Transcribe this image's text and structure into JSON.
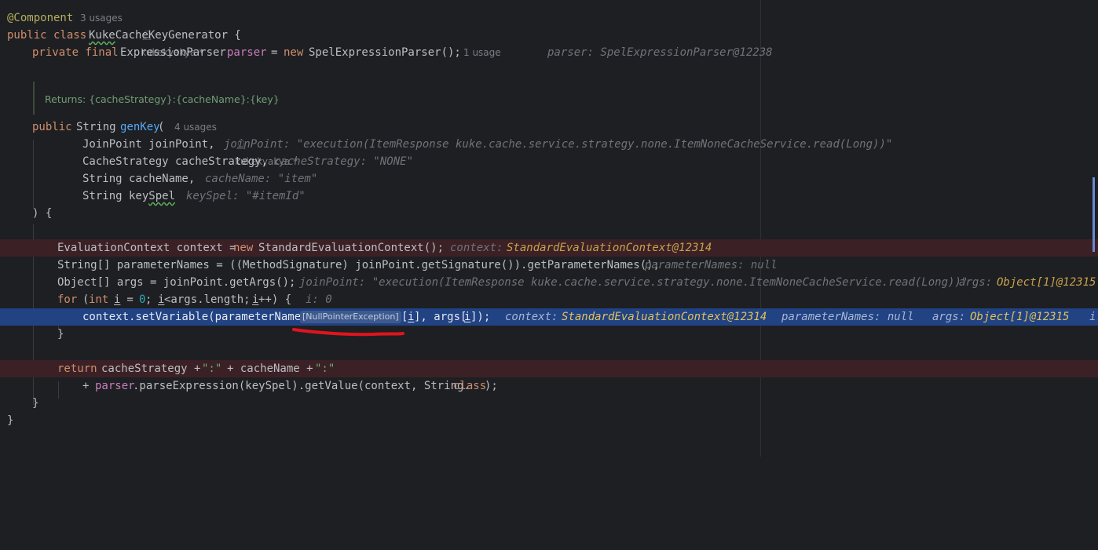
{
  "class_header": {
    "annotation": "@Component",
    "usages": "3 usages",
    "author": "kukekyakya *",
    "decl_kw": "public class",
    "class_prefix": "Kuke",
    "class_suffix": "CacheKeyGenerator {"
  },
  "field": {
    "modifiers": "private final",
    "type": "ExpressionParser",
    "name": "parser",
    "assign": "=",
    "new_kw": "new",
    "init": "SpelExpressionParser();",
    "usages": "1 usage",
    "hint": "parser: SpelExpressionParser@12238"
  },
  "doc": {
    "text": "Returns: {cacheStrategy}:{cacheName}:{key}"
  },
  "method": {
    "modifiers": "public",
    "return_type": "String",
    "name": "genKey",
    "paren": "(",
    "usages": "4 usages",
    "author": "kukekyakya *",
    "params": [
      {
        "code": "JoinPoint joinPoint,",
        "hint": "joinPoint: \"execution(ItemResponse kuke.cache.service.strategy.none.ItemNoneCacheService.read(Long))\""
      },
      {
        "code": "CacheStrategy cacheStrategy,",
        "hint": "cacheStrategy: \"NONE\""
      },
      {
        "code": "String cacheName,",
        "hint": "cacheName: \"item\""
      },
      {
        "code_prefix": "String key",
        "code_squig": "Spel",
        "hint": "keySpel: \"#itemId\""
      }
    ],
    "close": ") {"
  },
  "body": {
    "l1_code": "EvaluationContext context =",
    "l1_new": "new",
    "l1_rest": "StandardEvaluationContext();",
    "l1_hint_label": "context:",
    "l1_hint_val": "StandardEvaluationContext@12314",
    "l2_code": "String[] parameterNames = ((MethodSignature) joinPoint.getSignature()).getParameterNames();",
    "l2_hint": "parameterNames: null",
    "l3_code": "Object[] args = joinPoint.getArgs();",
    "l3_hint": "joinPoint: \"execution(ItemResponse kuke.cache.service.strategy.none.ItemNoneCacheService.read(Long))\"",
    "l3_hint2_label": "args:",
    "l3_hint2_val": "Object[1]@12315",
    "l4_for": "for",
    "l4_open": "(",
    "l4_int": "int",
    "l4_i": "i",
    "l4_eq": " =",
    "l4_zero": "0",
    "l4_semi": ";",
    "l4_cond": "<args.length; ",
    "l4_inc": "++) {",
    "l4_hint": "i: 0",
    "l5_code": "context.setVariable(parameterNames",
    "l5_badge": "[NullPointerException]",
    "l5_idx_open": "[",
    "l5_idx_close": "], args[",
    "l5_end": "]);",
    "l5_hint1_label": "context:",
    "l5_hint1_val": "StandardEvaluationContext@12314",
    "l5_hint2": "parameterNames: null",
    "l5_hint3_label": "args:",
    "l5_hint3_val": "Object[1]@12315",
    "l5_hint4": "i:",
    "close_brace": "}",
    "ret_kw": "return",
    "ret_code": "cacheStrategy +",
    "ret_str1": "\":\"",
    "ret_mid": "+ cacheName +",
    "ret_str2": "\":\"",
    "cont_plus": "+",
    "cont_field": "parser",
    "cont_rest": ".parseExpression(keySpel).getValue(context, String.",
    "cont_class": "class",
    "cont_end": ");",
    "method_close": "}",
    "class_close": "}"
  },
  "colors": {
    "background": "#1e1f22",
    "breakpoint_line": "#3b2126",
    "execution_line": "#214283",
    "annotation": "#b3ae60",
    "keyword": "#cf8e6d",
    "method": "#56a8f5",
    "field": "#c77dbb",
    "string": "#6aab73",
    "number": "#2aacb8",
    "hint_object": "#c8a24b",
    "red_underline": "#e0141e"
  }
}
